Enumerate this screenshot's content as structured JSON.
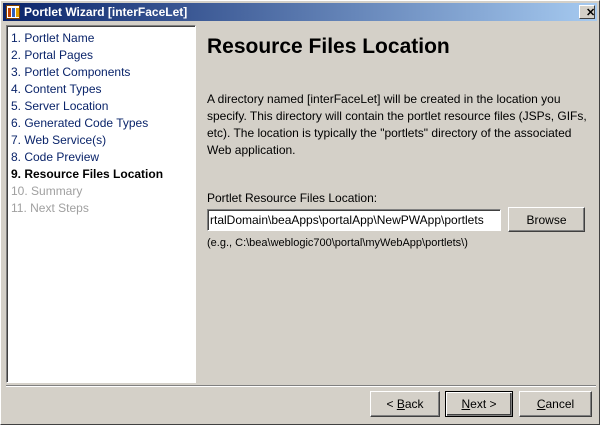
{
  "window": {
    "title": "Portlet Wizard [interFaceLet]",
    "close_glyph": "✕"
  },
  "steps": [
    {
      "label": "1. Portlet Name",
      "state": "done"
    },
    {
      "label": "2. Portal Pages",
      "state": "done"
    },
    {
      "label": "3. Portlet Components",
      "state": "done"
    },
    {
      "label": "4. Content Types",
      "state": "done"
    },
    {
      "label": "5. Server Location",
      "state": "done"
    },
    {
      "label": "6. Generated Code Types",
      "state": "done"
    },
    {
      "label": "7. Web Service(s)",
      "state": "done"
    },
    {
      "label": "8. Code Preview",
      "state": "done"
    },
    {
      "label": "9. Resource Files Location",
      "state": "current"
    },
    {
      "label": "10. Summary",
      "state": "todo"
    },
    {
      "label": "11. Next Steps",
      "state": "todo"
    }
  ],
  "main": {
    "heading": "Resource Files Location",
    "description": "A directory named [interFaceLet] will be created in the location you specify.  This directory will contain the portlet resource files (JSPs, GIFs, etc).  The location is typically the \"portlets\" directory of the associated Web application.",
    "field_label": "Portlet Resource Files Location:",
    "path_value": "rtalDomain\\beaApps\\portalApp\\NewPWApp\\portlets",
    "browse_label": "Browse",
    "example": "(e.g., C:\\bea\\weblogic700\\portal\\myWebApp\\portlets\\)"
  },
  "footer": {
    "back": {
      "mnemonic": "B",
      "rest": "ack",
      "prefix": "< ",
      "suffix": ""
    },
    "next": {
      "mnemonic": "N",
      "rest": "ext",
      "prefix": "",
      "suffix": " >"
    },
    "cancel": {
      "mnemonic": "C",
      "rest": "ancel",
      "prefix": "",
      "suffix": ""
    }
  },
  "colors": {
    "title_gradient_start": "#0a246a",
    "title_gradient_end": "#a6caf0",
    "step_done": "#0a246a",
    "step_todo": "#a0a0a0",
    "dialog_bg": "#d4d0c8"
  }
}
